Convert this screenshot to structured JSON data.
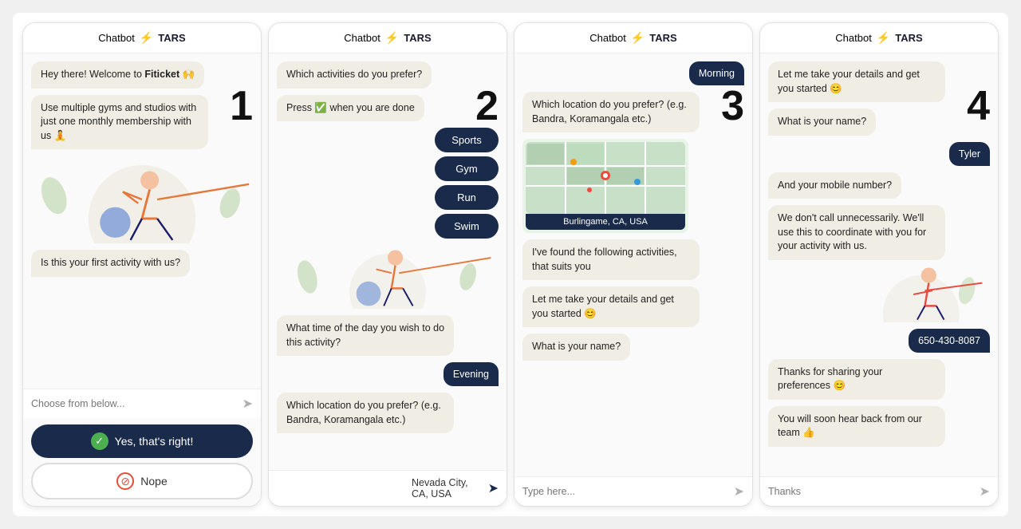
{
  "panels": [
    {
      "id": "panel-1",
      "number": "1",
      "header": {
        "chatbot_label": "Chatbot",
        "bolt": "⚡",
        "tars_label": "TARS"
      },
      "messages": [
        {
          "type": "bot",
          "text": "Hey there! Welcome to Fiticket 🙌"
        },
        {
          "type": "bot",
          "text": "Use multiple gyms and studios with just one monthly membership with us 🧘"
        },
        {
          "type": "bot",
          "text": "Is this your first activity with us?"
        }
      ],
      "input_placeholder": "Choose from below...",
      "buttons": [
        {
          "label": "Yes, that's right!",
          "type": "yes"
        },
        {
          "label": "Nope",
          "type": "no"
        }
      ]
    },
    {
      "id": "panel-2",
      "number": "2",
      "header": {
        "chatbot_label": "Chatbot",
        "bolt": "⚡",
        "tars_label": "TARS"
      },
      "messages": [
        {
          "type": "bot",
          "text": "Which activities do you prefer?"
        },
        {
          "type": "bot",
          "text": "Press ✅ when you are done"
        }
      ],
      "options": [
        "Sports",
        "Gym",
        "Run",
        "Swim"
      ],
      "messages2": [
        {
          "type": "bot",
          "text": "What time of the day you wish to do this activity?"
        }
      ],
      "user_response": "Evening",
      "messages3": [
        {
          "type": "bot",
          "text": "Which location do you prefer? (e.g. Bandra, Koramangala etc.)"
        }
      ],
      "input_value": "Nevada City, CA, USA"
    },
    {
      "id": "panel-3",
      "number": "3",
      "header": {
        "chatbot_label": "Chatbot",
        "bolt": "⚡",
        "tars_label": "TARS"
      },
      "user_response": "Morning",
      "messages": [
        {
          "type": "bot",
          "text": "Which location do you prefer? (e.g. Bandra, Koramangala etc.)"
        }
      ],
      "map_location": "Burlingame, CA, USA",
      "messages2": [
        {
          "type": "bot",
          "text": "I've found the following activities, that suits you"
        },
        {
          "type": "bot",
          "text": "Let me take your details and get you started 😊"
        },
        {
          "type": "bot",
          "text": "What is your name?"
        }
      ],
      "input_placeholder": "Type here..."
    },
    {
      "id": "panel-4",
      "number": "4",
      "header": {
        "chatbot_label": "Chatbot",
        "bolt": "⚡",
        "tars_label": "TARS"
      },
      "messages": [
        {
          "type": "bot",
          "text": "Let me take your details and get you started 😊"
        },
        {
          "type": "bot",
          "text": "What is your name?"
        }
      ],
      "user_name": "Tyler",
      "messages2": [
        {
          "type": "bot",
          "text": "And your mobile number?"
        },
        {
          "type": "bot",
          "text": "We don't call unnecessarily. We'll use this to coordinate with you for your activity with us."
        }
      ],
      "user_phone": "650-430-8087",
      "messages3": [
        {
          "type": "bot",
          "text": "Thanks for sharing your preferences 😊"
        },
        {
          "type": "bot",
          "text": "You will soon hear back from our team 👍"
        }
      ],
      "input_placeholder": "Thanks"
    }
  ]
}
